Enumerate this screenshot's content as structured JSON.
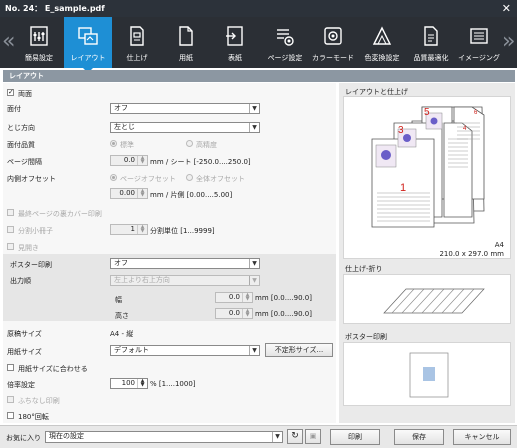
{
  "window": {
    "title": "No. 24： E_sample.pdf"
  },
  "tabs": [
    {
      "label": "簡易設定",
      "icon": "simple-settings-icon"
    },
    {
      "label": "レイアウト",
      "icon": "layout-icon"
    },
    {
      "label": "仕上げ",
      "icon": "finishing-icon"
    },
    {
      "label": "用紙",
      "icon": "paper-icon"
    },
    {
      "label": "表紙",
      "icon": "cover-icon"
    },
    {
      "label": "ページ設定",
      "icon": "page-settings-icon"
    },
    {
      "label": "カラーモード",
      "icon": "color-mode-icon"
    },
    {
      "label": "色変換設定",
      "icon": "color-conversion-icon"
    },
    {
      "label": "品質最適化",
      "icon": "quality-icon"
    },
    {
      "label": "イメージング",
      "icon": "imaging-icon"
    }
  ],
  "section": {
    "title": "レイアウト"
  },
  "layout": {
    "duplex_label": "両面",
    "binding_label": "面付",
    "binding_value": "オフ",
    "direction_label": "とじ方向",
    "direction_value": "左とじ",
    "quality_label": "面付品質",
    "quality_standard": "標準",
    "quality_high": "高精度",
    "page_gap_label": "ページ間隔",
    "page_gap_value": "0.0",
    "page_gap_unit": "mm / シート [-250.0....250.0]",
    "inner_offset_label": "内側オフセット",
    "offset_page": "ページオフセット",
    "offset_all": "全体オフセット",
    "offset_value": "0.00",
    "offset_unit": "mm / 片側 [0.00....5.00]",
    "last_cover_label": "最終ページの裏カバー印刷",
    "split_label": "分割小冊子",
    "split_value": "1",
    "split_unit": "分割単位 [1...9999]",
    "spread_label": "見開き"
  },
  "poster": {
    "label": "ポスター印刷",
    "value": "オフ",
    "order_label": "出力順",
    "order_value": "左上より右上方向",
    "width_label": "幅",
    "width_value": "0.0",
    "width_unit": "mm [0.0....90.0]",
    "height_label": "高さ",
    "height_value": "0.0",
    "height_unit": "mm [0.0....90.0]"
  },
  "paper": {
    "orig_size_label": "原稿サイズ",
    "orig_size_value": "A4 - 縦",
    "paper_size_label": "用紙サイズ",
    "paper_size_value": "デフォルト",
    "custom_size_btn": "不定形サイズ...",
    "fit_label": "用紙サイズに合わせる",
    "scale_label": "倍率設定",
    "scale_value": "100",
    "scale_unit": "% [1....1000]",
    "borderless_label": "ふちなし印刷",
    "rotate_label": "180°回転"
  },
  "preview": {
    "layout_title": "レイアウトと仕上げ",
    "page_numbers": [
      "1",
      "3",
      "5"
    ],
    "page_numbers_back": [
      "2",
      "4",
      "6"
    ],
    "size_name": "A4",
    "size_dims": "210.0 x 297.0 mm",
    "fold_title": "仕上げ-折り",
    "poster_title": "ポスター印刷"
  },
  "footer": {
    "favorites_label": "お気に入り",
    "favorites_value": "現在の設定",
    "print_btn": "印刷",
    "save_btn": "保存",
    "cancel_btn": "キャンセル"
  },
  "colors": {
    "accent": "#1e8fd5",
    "titlebar": "#2c323a",
    "tabbar": "#2b2f35",
    "page_number": "#d0201a"
  }
}
